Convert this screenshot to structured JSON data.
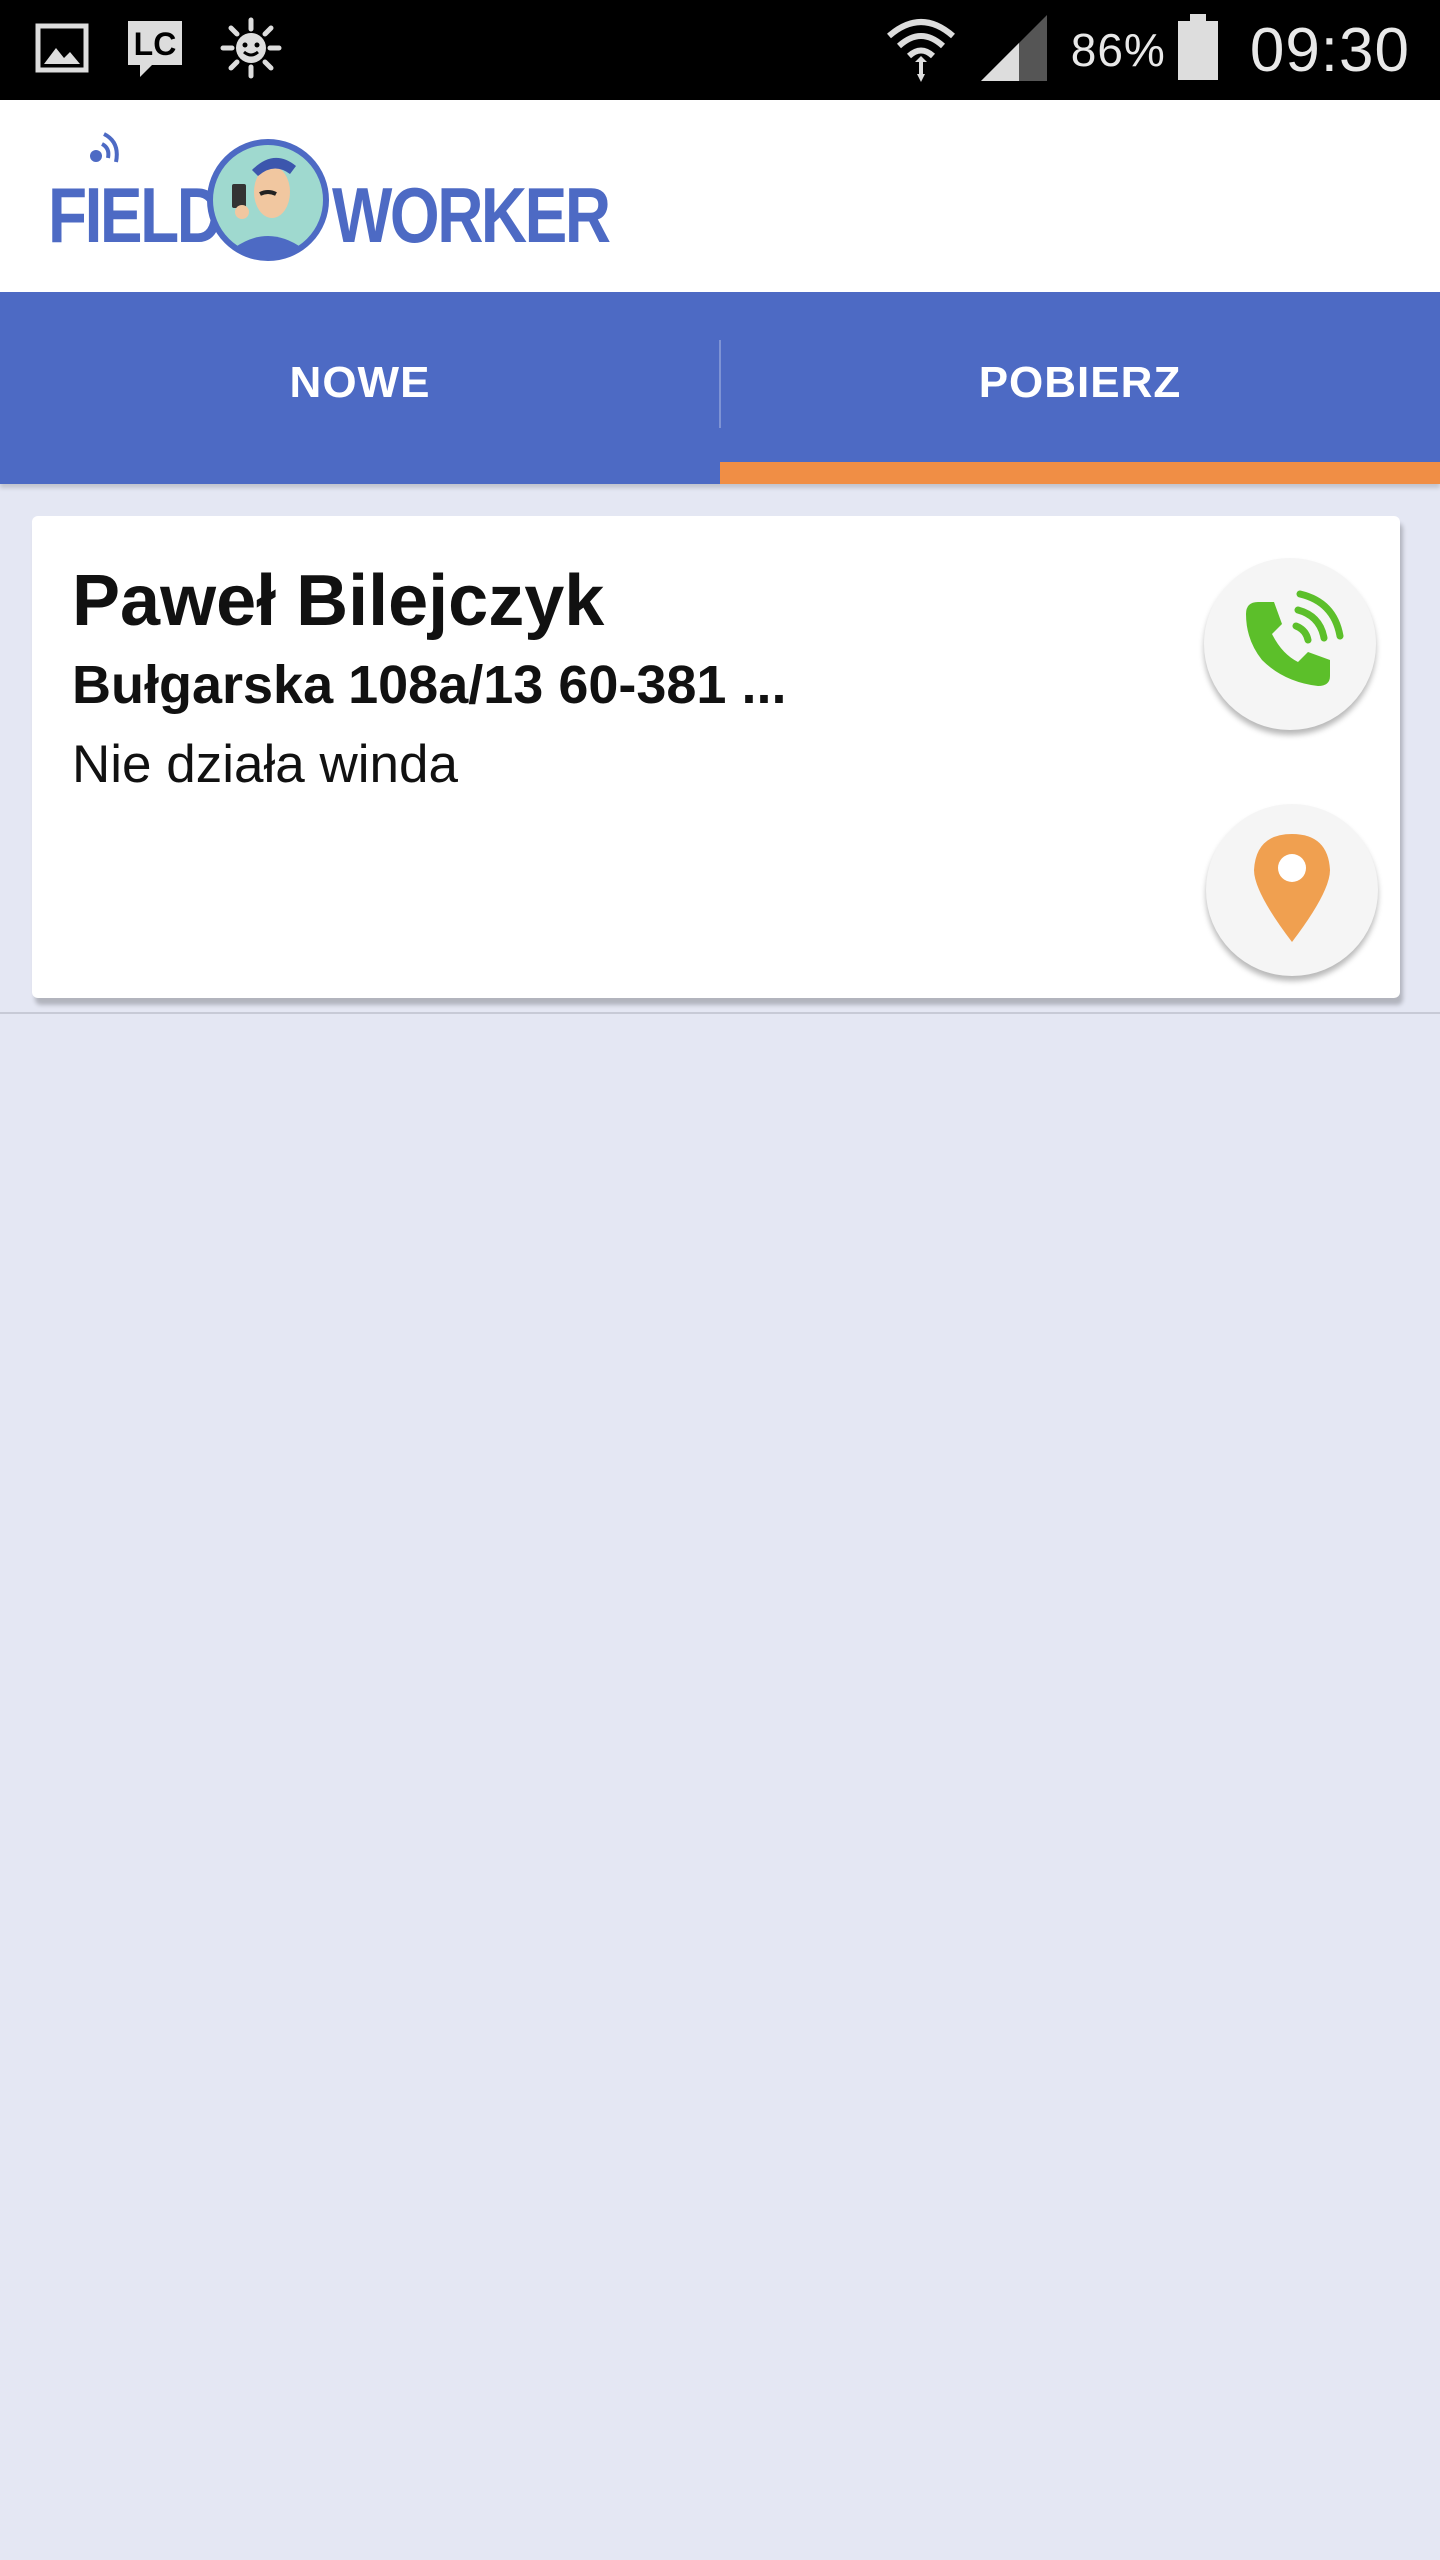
{
  "status_bar": {
    "battery_percent": "86%",
    "time": "09:30",
    "icons": [
      "image-icon",
      "lc-notification-icon",
      "settings-sun-icon",
      "wifi-icon",
      "signal-icon",
      "battery-icon"
    ]
  },
  "app_bar": {
    "logo_text_first": "FIELD",
    "logo_text_second": "WORKER"
  },
  "tabs": [
    {
      "label": "NOWE",
      "selected": false
    },
    {
      "label": "POBIERZ",
      "selected": true
    }
  ],
  "task_card": {
    "name": "Paweł Bilejczyk",
    "address": "Bułgarska 108a/13 60-381 ...",
    "description": "Nie działa winda",
    "icons": [
      "phone-call-icon",
      "map-pin-icon"
    ]
  },
  "colors": {
    "primary": "#4d6ac4",
    "accent": "#f08e45",
    "call_green": "#5cbf2a",
    "background": "#e4e7f3"
  }
}
